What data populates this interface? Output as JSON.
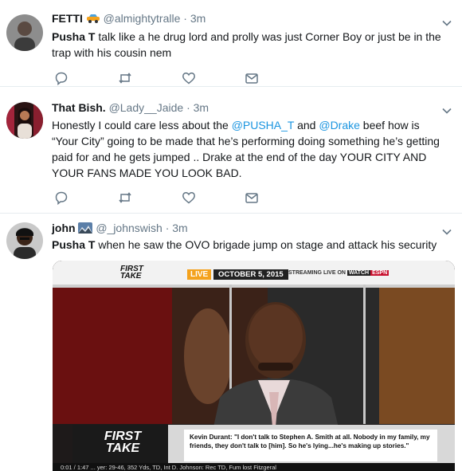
{
  "tweets": [
    {
      "name": "FETTI",
      "handle": "@almightytralle",
      "time": "3m",
      "text_parts": [
        "Pusha T",
        " talk like a he drug lord and prolly was just Corner Boy or just be in the trap with his cousin nem"
      ]
    },
    {
      "name": "That Bish.",
      "handle": "@Lady__Jaide",
      "time": "3m",
      "text_parts": [
        "Honestly I could care less about the ",
        "@PUSHA_T",
        " and ",
        "@Drake",
        " beef how is “Your City” going to be made that he’s performing doing something he’s getting paid for and he gets jumped .. Drake at the end of the day YOUR CITY AND YOUR FANS MADE YOU LOOK BAD."
      ]
    },
    {
      "name": "john",
      "handle": "@_johnswish",
      "time": "3m",
      "text_parts": [
        "Pusha T",
        " when he saw the OVO brigade jump on stage and attack his security"
      ]
    }
  ],
  "separator": "·",
  "video": {
    "logo_top": "FIRST\nTAKE",
    "live_label": "LIVE",
    "date": "OCTOBER 5, 2015",
    "streaming": "STREAMING LIVE ON",
    "watch": "WATCH",
    "network": "ESPN",
    "logo_bottom_1": "FIRST",
    "logo_bottom_2": "TAKE",
    "quote": "Kevin Durant: \"I don't talk to Stephen A. Smith at all. Nobody in my family, my friends, they don't talk to [him]. So he's lying...he's making up stories.\"",
    "ticker": "0:01 / 1:47   ...   yer: 29-46, 352 Yds, TD, Int   D. Johnson: Rec TD, Fum lost   Fitzgeral"
  },
  "colors": {
    "link": "#1b95e0",
    "muted": "#657786",
    "icon": "#657786",
    "divider": "#e6ecf0"
  },
  "icons": [
    "chevron-down-icon",
    "reply-icon",
    "retweet-icon",
    "like-icon",
    "direct-message-icon",
    "car-emoji",
    "sunrise-emoji"
  ]
}
